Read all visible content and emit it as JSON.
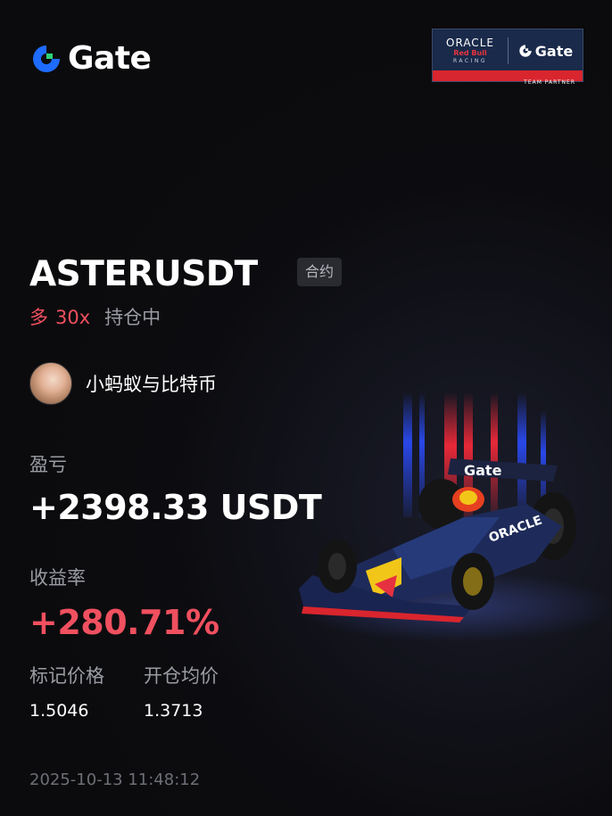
{
  "brand": {
    "logo_text": "Gate",
    "logo_icon": "gate-logo-icon",
    "accent_blue": "#1e6bff",
    "accent_green": "#2fd47a"
  },
  "partner_badge": {
    "oracle": "ORACLE",
    "redbull": "Red Bull",
    "racing": "RACING",
    "gate": "Gate",
    "team_partner": "TEAM PARTNER"
  },
  "position": {
    "symbol": "ASTERUSDT",
    "contract_tag": "合约",
    "side": "多",
    "leverage": "30x",
    "status": "持仓中"
  },
  "user": {
    "name": "小蚂蚁与比特币"
  },
  "pnl": {
    "label": "盈亏",
    "value": "+2398.33 USDT"
  },
  "roi": {
    "label": "收益率",
    "value": "+280.71%"
  },
  "prices": {
    "mark_label": "标记价格",
    "mark_value": "1.5046",
    "entry_label": "开仓均价",
    "entry_value": "1.3713"
  },
  "timestamp": "2025-10-13 11:48:12",
  "colors": {
    "positive": "#f0505f",
    "muted": "#9a9ca3",
    "background": "#0b0b0d"
  }
}
